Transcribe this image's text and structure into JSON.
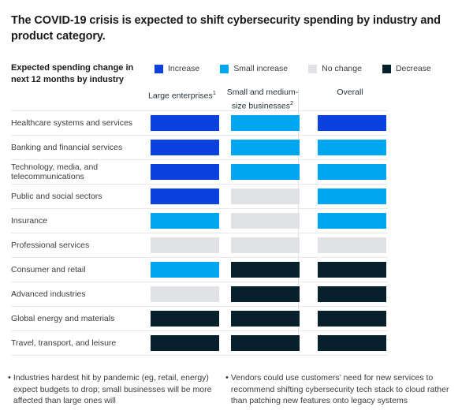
{
  "title": "The COVID-19 crisis is expected to shift cybersecurity spending by industry and product category.",
  "left_heading": "Expected spending change in next 12 months by industry",
  "legend": {
    "items": [
      {
        "label": "Increase",
        "color": "#0b41dc",
        "key": "increase"
      },
      {
        "label": "Small increase",
        "color": "#00a7f0",
        "key": "small_increase"
      },
      {
        "label": "No change",
        "color": "#e0e2e6",
        "key": "no_change"
      },
      {
        "label": "Decrease",
        "color": "#07202c",
        "key": "decrease"
      }
    ]
  },
  "columns": [
    {
      "label": "Large enterprises",
      "sup": "1"
    },
    {
      "label": "Small and medium-size businesses",
      "sup": "2"
    },
    {
      "label": "Overall",
      "sup": ""
    }
  ],
  "rows": [
    {
      "label": "Healthcare systems and services",
      "values": [
        "increase",
        "small_increase",
        "increase"
      ]
    },
    {
      "label": "Banking and financial services",
      "values": [
        "increase",
        "small_increase",
        "small_increase"
      ]
    },
    {
      "label": "Technology, media, and telecommunications",
      "values": [
        "increase",
        "small_increase",
        "small_increase"
      ]
    },
    {
      "label": "Public and social sectors",
      "values": [
        "increase",
        "no_change",
        "small_increase"
      ]
    },
    {
      "label": "Insurance",
      "values": [
        "small_increase",
        "no_change",
        "small_increase"
      ]
    },
    {
      "label": "Professional services",
      "values": [
        "no_change",
        "no_change",
        "no_change"
      ]
    },
    {
      "label": "Consumer and retail",
      "values": [
        "small_increase",
        "decrease",
        "decrease"
      ]
    },
    {
      "label": "Advanced industries",
      "values": [
        "no_change",
        "decrease",
        "decrease"
      ]
    },
    {
      "label": "Global energy and materials",
      "values": [
        "decrease",
        "decrease",
        "decrease"
      ]
    },
    {
      "label": "Travel, transport, and leisure",
      "values": [
        "decrease",
        "decrease",
        "decrease"
      ]
    }
  ],
  "footnotes": [
    {
      "bullet": "•",
      "text": "Industries hardest hit by pandemic (eg, retail, energy) expect budgets to drop; small businesses will be more affected than large ones will"
    },
    {
      "bullet": "•",
      "text": "Vendors could use customers’ need for new services to recommend shifting cybersecurity tech stack to cloud rather than patching new features onto legacy systems"
    }
  ],
  "chart_data": {
    "type": "heatmap",
    "title": "The COVID-19 crisis is expected to shift cybersecurity spending by industry and product category.",
    "xlabel": "",
    "ylabel": "Expected spending change in next 12 months by industry",
    "grid": false,
    "legend_position": "top",
    "categories": [
      "Large enterprises",
      "Small and medium-size businesses",
      "Overall"
    ],
    "value_scale": [
      {
        "key": "increase",
        "label": "Increase",
        "color": "#0b41dc",
        "level": 2
      },
      {
        "key": "small_increase",
        "label": "Small increase",
        "color": "#00a7f0",
        "level": 1
      },
      {
        "key": "no_change",
        "label": "No change",
        "color": "#e0e2e6",
        "level": 0
      },
      {
        "key": "decrease",
        "label": "Decrease",
        "color": "#07202c",
        "level": -1
      }
    ],
    "series": [
      {
        "name": "Healthcare systems and services",
        "values": [
          "increase",
          "small_increase",
          "increase"
        ]
      },
      {
        "name": "Banking and financial services",
        "values": [
          "increase",
          "small_increase",
          "small_increase"
        ]
      },
      {
        "name": "Technology, media, and telecommunications",
        "values": [
          "increase",
          "small_increase",
          "small_increase"
        ]
      },
      {
        "name": "Public and social sectors",
        "values": [
          "increase",
          "no_change",
          "small_increase"
        ]
      },
      {
        "name": "Insurance",
        "values": [
          "small_increase",
          "no_change",
          "small_increase"
        ]
      },
      {
        "name": "Professional services",
        "values": [
          "no_change",
          "no_change",
          "no_change"
        ]
      },
      {
        "name": "Consumer and retail",
        "values": [
          "small_increase",
          "decrease",
          "decrease"
        ]
      },
      {
        "name": "Advanced industries",
        "values": [
          "no_change",
          "decrease",
          "decrease"
        ]
      },
      {
        "name": "Global energy and materials",
        "values": [
          "decrease",
          "decrease",
          "decrease"
        ]
      },
      {
        "name": "Travel, transport, and leisure",
        "values": [
          "decrease",
          "decrease",
          "decrease"
        ]
      }
    ]
  }
}
